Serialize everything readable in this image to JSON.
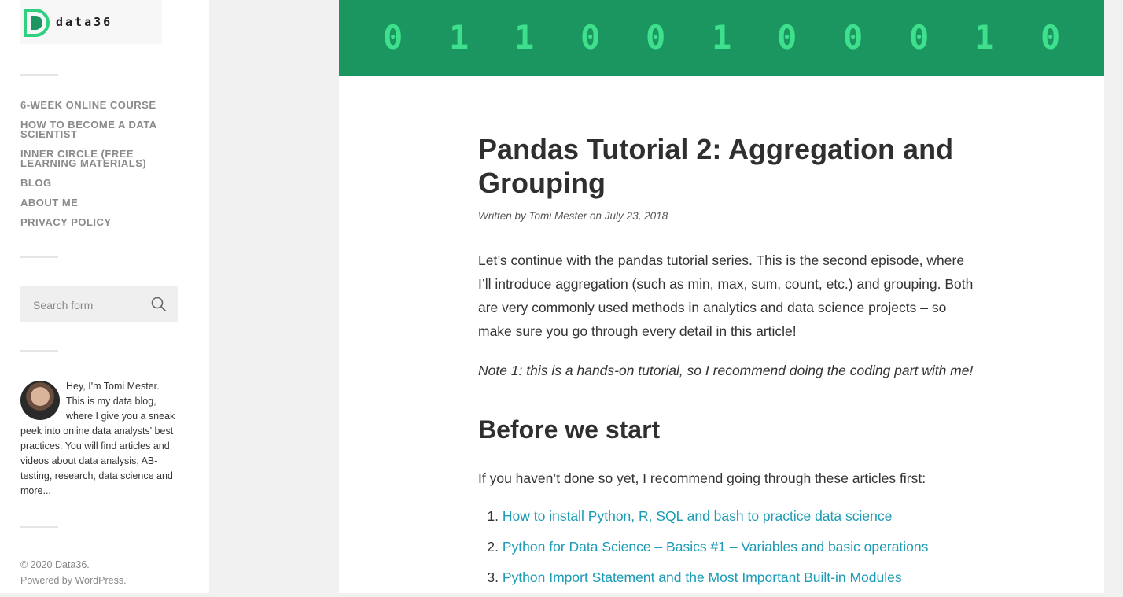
{
  "logo": {
    "text": "data36"
  },
  "nav": {
    "items": [
      "6-WEEK ONLINE COURSE",
      "HOW TO BECOME A DATA SCIENTIST",
      "INNER CIRCLE (FREE LEARNING MATERIALS)",
      "BLOG",
      "ABOUT ME",
      "PRIVACY POLICY"
    ]
  },
  "search": {
    "placeholder": "Search form"
  },
  "bio": {
    "text": "Hey, I'm Tomi Mester. This is my data blog, where I give you a sneak peek into online data analysts' best practices. You will find articles and videos about data analysis, AB-testing, research, data science and more..."
  },
  "footer": {
    "copyright": "© 2020 Data36.",
    "powered": "Powered by WordPress."
  },
  "header": {
    "digits": [
      "0",
      "1",
      "1",
      "0",
      "0",
      "1",
      "0",
      "0",
      "0",
      "1",
      "0"
    ]
  },
  "article": {
    "title": "Pandas Tutorial 2: Aggregation and Grouping",
    "meta": "Written by Tomi Mester on July 23, 2018",
    "intro": "Let’s continue with the pandas tutorial series. This is the second episode, where I’ll introduce aggregation (such as min, max, sum, count, etc.) and grouping. Both are very commonly used methods in analytics and data science projects – so make sure you go through every detail in this article!",
    "note": "Note 1: this is a hands-on tutorial, so I recommend doing the coding part with me!",
    "section_heading": "Before we start",
    "section_text": "If you haven’t done so yet, I recommend going through these articles first:",
    "links": [
      {
        "num": "1.",
        "label": "How to install Python, R, SQL and bash to practice data science"
      },
      {
        "num": "2.",
        "label": "Python for Data Science – Basics #1 – Variables and basic operations"
      },
      {
        "num": "3.",
        "label": "Python Import Statement and the Most Important Built-in Modules"
      }
    ]
  },
  "colors": {
    "brand_green": "#1b9660",
    "digit_green": "#3fe08d",
    "link": "#1b9bb5"
  }
}
